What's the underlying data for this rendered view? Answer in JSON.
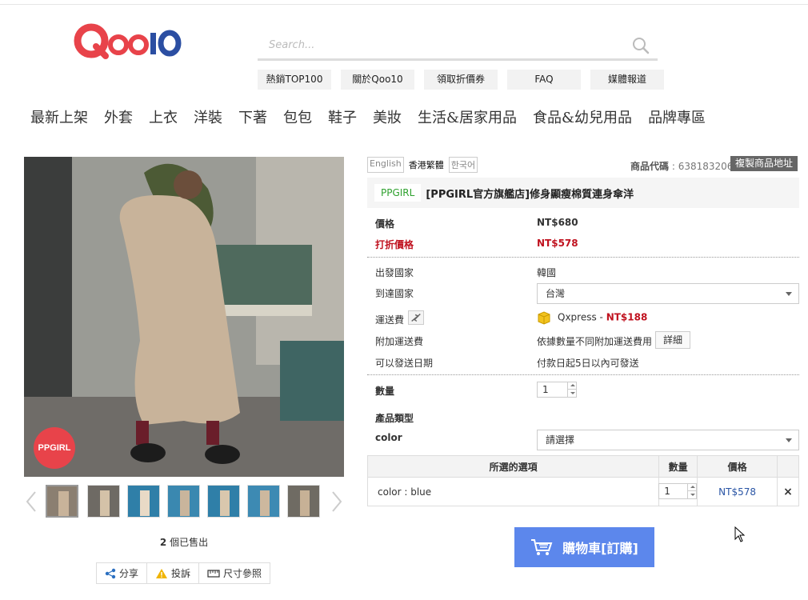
{
  "header": {
    "logo_text": "Qoo10",
    "search_placeholder": "Search...",
    "quick_links": [
      "熱銷TOP100",
      "關於Qoo10",
      "領取折價券",
      "FAQ",
      "媒體報道"
    ]
  },
  "categories": [
    "最新上架",
    "外套",
    "上衣",
    "洋裝",
    "下著",
    "包包",
    "鞋子",
    "美妝",
    "生活&居家用品",
    "食品&幼兒用品",
    "品牌專區"
  ],
  "gallery": {
    "brand_badge": "PPGIRL",
    "sold_count": "2",
    "sold_suffix": " 個已售出",
    "share_label": "分享",
    "report_label": "投訴",
    "size_label": "尺寸參照"
  },
  "product": {
    "languages": [
      "English",
      "香港繁體",
      "한국어"
    ],
    "code_label": "商品代碼",
    "code_value": "638183206",
    "copy_url_label": "複製商品地址",
    "brand": "PPGIRL",
    "title": "[PPGIRL官方旗艦店]修身顯瘦棉質連身傘洋",
    "price_label": "價格",
    "price": "NT$680",
    "discount_label": "打折價格",
    "discount_price": "NT$578",
    "origin_label": "出發國家",
    "origin": "韓國",
    "dest_label": "到達國家",
    "dest": "台灣",
    "shipping_label": "運送費",
    "shipping_method": "Qxpress - ",
    "shipping_fee": "NT$188",
    "extra_shipping_label": "附加運送費",
    "extra_shipping": "依據數量不同附加運送費用",
    "detail_button": "詳細",
    "ship_date_label": "可以發送日期",
    "ship_date": "付款日起5日以內可發送",
    "qty_label": "數量",
    "qty": "1",
    "type_label": "產品類型",
    "color_label": "color",
    "color_select": "請選擇"
  },
  "options_table": {
    "headers": [
      "所選的選項",
      "數量",
      "價格"
    ],
    "rows": [
      {
        "option": "color : blue",
        "qty": "1",
        "price": "NT$578",
        "remove": "×"
      }
    ]
  },
  "cart_button": "購物車[訂購]",
  "colors": {
    "brand_red": "#e8434a",
    "discount_red": "#c0121f",
    "cart_blue": "#5c87ec",
    "brand_green": "#2fa12f"
  }
}
